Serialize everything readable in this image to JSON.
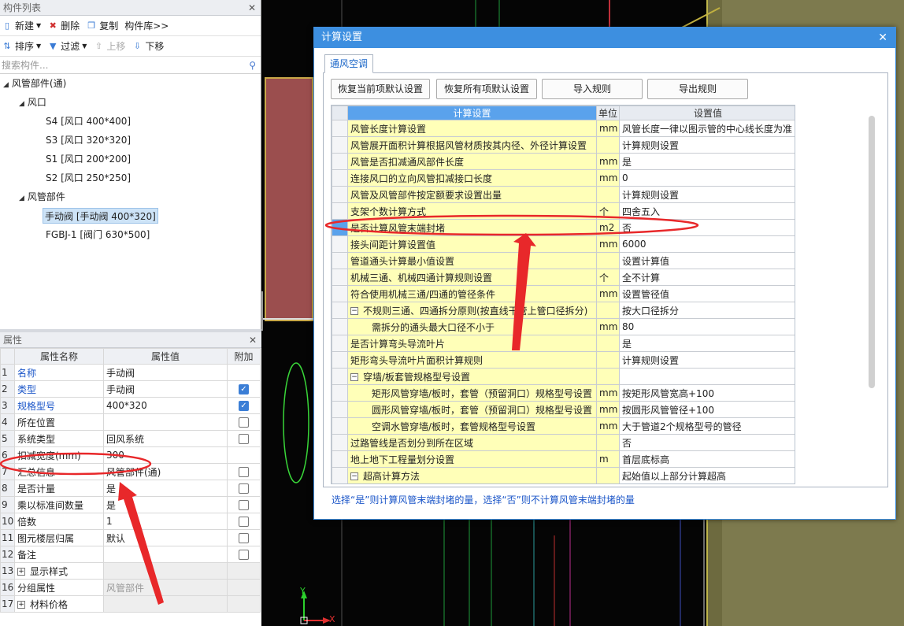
{
  "left_panel": {
    "title": "构件列表",
    "toolbar1": {
      "new": "新建",
      "delete": "删除",
      "copy": "复制",
      "library": "构件库>>"
    },
    "toolbar2": {
      "sort": "排序",
      "filter": "过滤",
      "move_up": "上移",
      "move_down": "下移"
    },
    "search_placeholder": "搜索构件...",
    "tree": {
      "root": "风管部件(通)",
      "group1": "风口",
      "items1": [
        "S4 [风口 400*400]",
        "S3 [风口 320*320]",
        "S1 [风口 200*200]",
        "S2 [风口 250*250]"
      ],
      "group2": "风管部件",
      "items2": [
        "手动阀 [手动阀 400*320]",
        "FGBJ-1 [阀门 630*500]"
      ]
    }
  },
  "properties": {
    "title": "属性",
    "headers": {
      "name": "属性名称",
      "value": "属性值",
      "extra": "附加"
    },
    "rows": [
      {
        "n": "1",
        "name": "名称",
        "value": "手动阀",
        "blue": true,
        "check": "none"
      },
      {
        "n": "2",
        "name": "类型",
        "value": "手动阀",
        "blue": true,
        "check": "on"
      },
      {
        "n": "3",
        "name": "规格型号",
        "value": "400*320",
        "blue": true,
        "check": "on"
      },
      {
        "n": "4",
        "name": "所在位置",
        "value": "",
        "blue": false,
        "check": "off"
      },
      {
        "n": "5",
        "name": "系统类型",
        "value": "回风系统",
        "blue": false,
        "check": "off"
      },
      {
        "n": "6",
        "name": "扣减宽度(mm)",
        "value": "300",
        "blue": false,
        "check": "none"
      },
      {
        "n": "7",
        "name": "汇总信息",
        "value": "风管部件(通)",
        "blue": false,
        "check": "off"
      },
      {
        "n": "8",
        "name": "是否计量",
        "value": "是",
        "blue": false,
        "check": "off"
      },
      {
        "n": "9",
        "name": "乘以标准间数量",
        "value": "是",
        "blue": false,
        "check": "off"
      },
      {
        "n": "10",
        "name": "倍数",
        "value": "1",
        "blue": false,
        "check": "off"
      },
      {
        "n": "11",
        "name": "图元楼层归属",
        "value": "默认",
        "blue": false,
        "check": "off"
      },
      {
        "n": "12",
        "name": "备注",
        "value": "",
        "blue": false,
        "check": "off"
      },
      {
        "n": "13",
        "name": "显示样式",
        "value": "",
        "blue": false,
        "check": "gray",
        "expand": true
      },
      {
        "n": "16",
        "name": "分组属性",
        "value": "风管部件",
        "blue": false,
        "check": "gray",
        "grayval": true
      },
      {
        "n": "17",
        "name": "材料价格",
        "value": "",
        "blue": false,
        "check": "gray",
        "expand": true
      }
    ]
  },
  "dialog": {
    "title": "计算设置",
    "tab": "通风空调",
    "buttons": [
      "恢复当前项默认设置",
      "恢复所有项默认设置",
      "导入规则",
      "导出规则"
    ],
    "headers": {
      "setting": "计算设置",
      "unit": "单位",
      "value": "设置值"
    },
    "rows": [
      {
        "t": "风管长度计算设置",
        "u": "mm",
        "v": "风管长度一律以图示管的中心线长度为准",
        "lvl": 0
      },
      {
        "t": "风管展开面积计算根据风管材质按其内径、外径计算设置",
        "u": "",
        "v": "计算规则设置",
        "lvl": 0
      },
      {
        "t": "风管是否扣减通风部件长度",
        "u": "mm",
        "v": "是",
        "lvl": 0
      },
      {
        "t": "连接风口的立向风管扣减接口长度",
        "u": "mm",
        "v": "0",
        "lvl": 0
      },
      {
        "t": "风管及风管部件按定额要求设置出量",
        "u": "",
        "v": "计算规则设置",
        "lvl": 0
      },
      {
        "t": "支架个数计算方式",
        "u": "个",
        "v": "四舍五入",
        "lvl": 0
      },
      {
        "t": "是否计算风管末端封堵",
        "u": "m2",
        "v": "否",
        "lvl": 0,
        "selected": true
      },
      {
        "t": "接头间距计算设置值",
        "u": "mm",
        "v": "6000",
        "lvl": 0
      },
      {
        "t": "管道通头计算最小值设置",
        "u": "",
        "v": "设置计算值",
        "lvl": 0
      },
      {
        "t": "机械三通、机械四通计算规则设置",
        "u": "个",
        "v": "全不计算",
        "lvl": 0
      },
      {
        "t": "符合使用机械三通/四通的管径条件",
        "u": "mm",
        "v": "设置管径值",
        "lvl": 0
      },
      {
        "t": "不规则三通、四通拆分原则(按直线干管上管口径拆分)",
        "u": "",
        "v": "按大口径拆分",
        "lvl": 0,
        "group": true
      },
      {
        "t": "需拆分的通头最大口径不小于",
        "u": "mm",
        "v": "80",
        "lvl": 1
      },
      {
        "t": "是否计算弯头导流叶片",
        "u": "",
        "v": "是",
        "lvl": 0
      },
      {
        "t": "矩形弯头导流叶片面积计算规则",
        "u": "",
        "v": "计算规则设置",
        "lvl": 0
      },
      {
        "t": "穿墙/板套管规格型号设置",
        "u": "",
        "v": "",
        "lvl": 0,
        "group": true
      },
      {
        "t": "矩形风管穿墙/板时，套管（预留洞口）规格型号设置",
        "u": "mm",
        "v": "按矩形风管宽高+100",
        "lvl": 1
      },
      {
        "t": "圆形风管穿墙/板时，套管（预留洞口）规格型号设置",
        "u": "mm",
        "v": "按圆形风管管径+100",
        "lvl": 1
      },
      {
        "t": "空调水管穿墙/板时，套管规格型号设置",
        "u": "mm",
        "v": "大于管道2个规格型号的管径",
        "lvl": 1
      },
      {
        "t": "过路管线是否划分到所在区域",
        "u": "",
        "v": "否",
        "lvl": 0
      },
      {
        "t": "地上地下工程量划分设置",
        "u": "m",
        "v": "首层底标高",
        "lvl": 0
      },
      {
        "t": "超高计算方法",
        "u": "",
        "v": "起始值以上部分计算超高",
        "lvl": 0,
        "group": true
      }
    ],
    "hint": "选择“是”则计算风管末端封堵的量，选择“否”则不计算风管末端封堵的量"
  },
  "axis": {
    "y": "Y",
    "x": "X"
  },
  "colors": {
    "accent": "#3d8fe0",
    "annotation": "#e8282a",
    "highlight_yellow": "#ffffb8"
  }
}
